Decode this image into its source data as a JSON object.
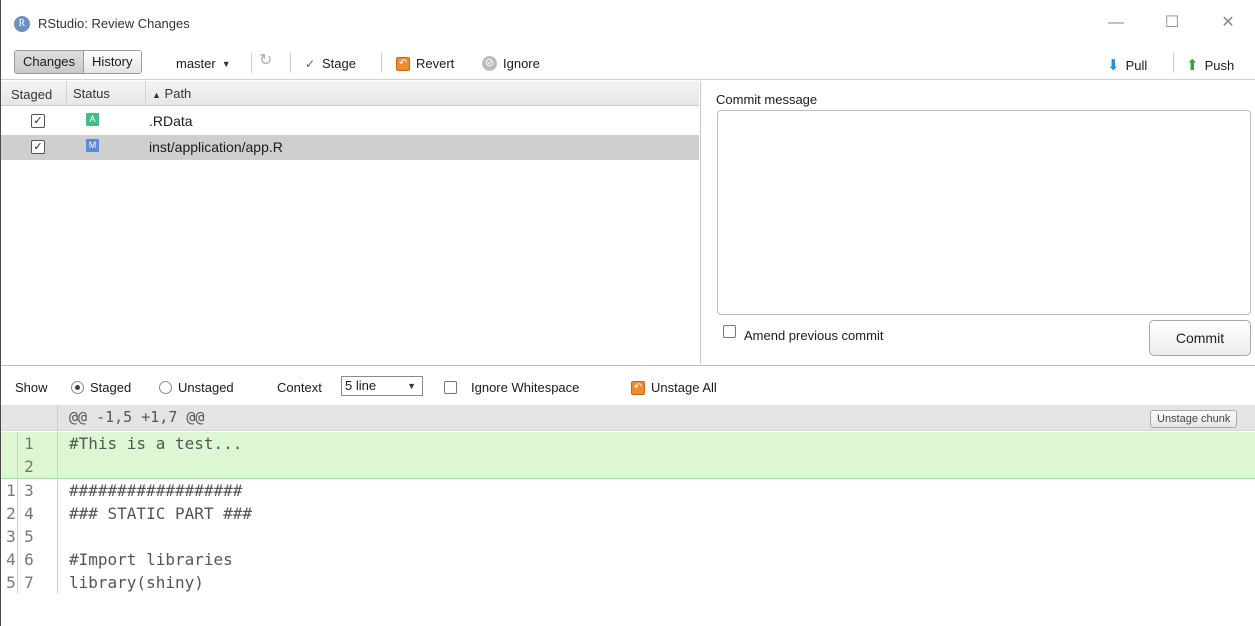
{
  "window": {
    "title": "RStudio: Review Changes",
    "app_icon_letter": "R",
    "min_glyph": "—",
    "max_glyph": "☐",
    "close_glyph": "✕"
  },
  "toolbar": {
    "tabs": [
      {
        "label": "Changes",
        "active": true
      },
      {
        "label": "History",
        "active": false
      }
    ],
    "branch": "master",
    "stage_label": "Stage",
    "revert_label": "Revert",
    "ignore_label": "Ignore",
    "pull_label": "Pull",
    "push_label": "Push"
  },
  "file_list": {
    "headers": {
      "staged": "Staged",
      "status": "Status",
      "path": "Path"
    },
    "sort_indicator": "▲",
    "rows": [
      {
        "staged": true,
        "status": "A",
        "path": ".RData",
        "selected": false
      },
      {
        "staged": true,
        "status": "M",
        "path": "inst/application/app.R",
        "selected": true
      }
    ]
  },
  "commit": {
    "label": "Commit message",
    "message": "",
    "amend_label": "Amend previous commit",
    "commit_button": "Commit"
  },
  "options": {
    "show_label": "Show",
    "staged_label": "Staged",
    "unstaged_label": "Unstaged",
    "context_label": "Context",
    "context_value": "5 line",
    "ignore_ws_label": "Ignore Whitespace",
    "unstage_all_label": "Unstage All"
  },
  "diff": {
    "chunk_header": "@@ -1,5 +1,7 @@",
    "unstage_chunk_label": "Unstage chunk",
    "lines": [
      {
        "old": "",
        "new": "1",
        "text": "#This is a test...",
        "type": "added"
      },
      {
        "old": "",
        "new": "2",
        "text": "",
        "type": "added"
      },
      {
        "old": "1",
        "new": "3",
        "text": "##################",
        "type": "context"
      },
      {
        "old": "2",
        "new": "4",
        "text": "### STATIC PART ###",
        "type": "context"
      },
      {
        "old": "3",
        "new": "5",
        "text": "",
        "type": "context"
      },
      {
        "old": "4",
        "new": "6",
        "text": "#Import libraries",
        "type": "context"
      },
      {
        "old": "5",
        "new": "7",
        "text": "library(shiny)",
        "type": "context"
      }
    ]
  }
}
